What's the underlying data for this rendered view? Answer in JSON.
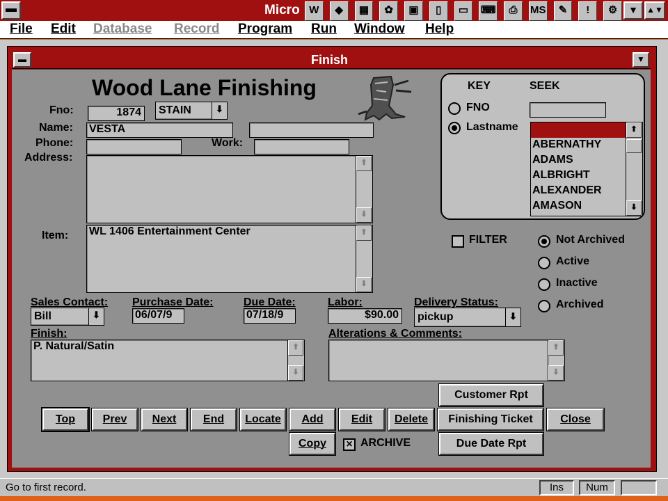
{
  "app": {
    "title": "Micro",
    "toolbar_icons": [
      "word-icon",
      "rose-icon",
      "graph-icon",
      "fox-icon",
      "calc-icon",
      "pda-icon",
      "monitor-icon",
      "keyboard-icon",
      "printer-icon",
      "msdos-icon",
      "tools-icon",
      "alert-icon",
      "gears-icon"
    ],
    "toolbar_glyphs": [
      "W",
      "◆",
      "▦",
      "✿",
      "▣",
      "▯",
      "▭",
      "⌨",
      "⎙",
      "MS",
      "✎",
      "!",
      "⚙"
    ]
  },
  "menu": [
    "File",
    "Edit",
    "Database",
    "Record",
    "Program",
    "Run",
    "Window",
    "Help"
  ],
  "window": {
    "title": "Finish"
  },
  "form": {
    "heading": "Wood Lane Finishing",
    "fno_label": "Fno:",
    "fno_value": "1874",
    "type_value": "STAIN",
    "name_label": "Name:",
    "name_value": "VESTA",
    "name_value2": "",
    "phone_label": "Phone:",
    "phone_value": "",
    "work_label": "Work:",
    "work_value": "",
    "address_label": "Address:",
    "address_value": "",
    "item_label": "Item:",
    "item_value": "WL 1406 Entertainment Center",
    "sales_contact_label": "Sales Contact:",
    "sales_contact_value": "Bill",
    "purchase_date_label": "Purchase Date:",
    "purchase_date_value": "06/07/9",
    "due_date_label": "Due Date:",
    "due_date_value": "07/18/9",
    "labor_label": "Labor:",
    "labor_value": "$90.00",
    "delivery_status_label": "Delivery Status:",
    "delivery_status_value": "pickup",
    "finish_label": "Finish:",
    "finish_value": "P. Natural/Satin",
    "alterations_label": "Alterations & Comments:",
    "alterations_value": ""
  },
  "seek": {
    "key_label": "KEY",
    "seek_label": "SEEK",
    "fno_option": "FNO",
    "lastname_option": "Lastname",
    "selected_key": "Lastname",
    "seek_value": "",
    "names": [
      "",
      "ABERNATHY",
      "ADAMS",
      "ALBRIGHT",
      "ALEXANDER",
      "AMASON"
    ]
  },
  "filter": {
    "filter_label": "FILTER",
    "filter_checked": false,
    "options": [
      "Not Archived",
      "Active",
      "Inactive",
      "Archived"
    ],
    "selected": "Not Archived"
  },
  "buttons": {
    "top": "Top",
    "prev": "Prev",
    "next": "Next",
    "end": "End",
    "locate": "Locate",
    "add": "Add",
    "edit": "Edit",
    "delete": "Delete",
    "finishing_ticket": "Finishing Ticket",
    "close": "Close",
    "customer_rpt": "Customer Rpt",
    "copy": "Copy",
    "archive": "ARCHIVE",
    "archive_checked": true,
    "due_date_rpt": "Due Date Rpt"
  },
  "status": {
    "message": "Go to first record.",
    "ins": "Ins",
    "num": "Num",
    "extra": ""
  },
  "colors": {
    "desktop": "#e0621a",
    "title_bar": "#a01010",
    "face": "#c0c0c0",
    "form_bg": "#909090"
  }
}
